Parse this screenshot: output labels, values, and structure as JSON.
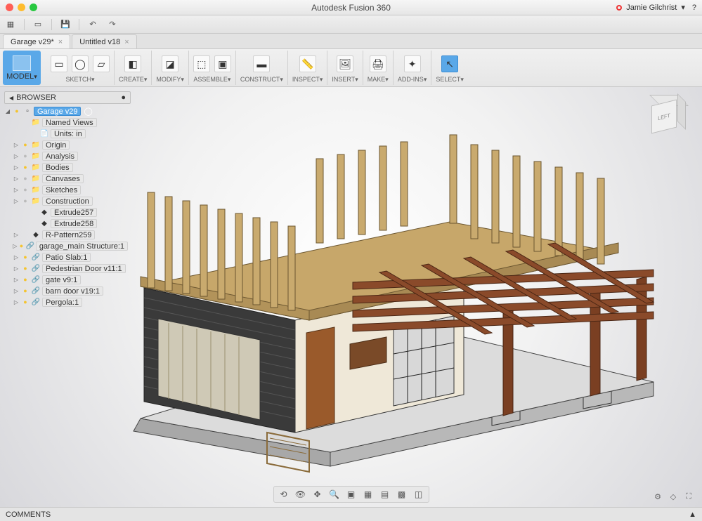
{
  "app_title": "Autodesk Fusion 360",
  "user_name": "Jamie Gilchrist",
  "tabs": [
    {
      "label": "Garage v29*",
      "active": true
    },
    {
      "label": "Untitled v18",
      "active": false
    }
  ],
  "ribbon": {
    "workspace": "MODEL",
    "groups": [
      {
        "label": "SKETCH",
        "icons": [
          "sketch-rect-icon",
          "sketch-circle-icon",
          "sketch-plane-icon"
        ]
      },
      {
        "label": "CREATE",
        "icons": [
          "extrude-icon"
        ]
      },
      {
        "label": "MODIFY",
        "icons": [
          "presspull-icon"
        ]
      },
      {
        "label": "ASSEMBLE",
        "icons": [
          "assemble-icon",
          "component-icon"
        ]
      },
      {
        "label": "CONSTRUCT",
        "icons": [
          "plane-icon"
        ]
      },
      {
        "label": "INSPECT",
        "icons": [
          "measure-icon"
        ]
      },
      {
        "label": "INSERT",
        "icons": [
          "insert-icon"
        ]
      },
      {
        "label": "MAKE",
        "icons": [
          "make-icon"
        ]
      },
      {
        "label": "ADD-INS",
        "icons": [
          "addins-icon"
        ]
      },
      {
        "label": "SELECT",
        "icons": [
          "select-icon"
        ],
        "selected": true
      }
    ]
  },
  "browser": {
    "title": "BROWSER",
    "root": "Garage v29",
    "items": [
      {
        "depth": 1,
        "tri": "",
        "bulb": "",
        "ico": "folder",
        "label": "Named Views"
      },
      {
        "depth": 2,
        "tri": "",
        "bulb": "",
        "ico": "doc",
        "label": "Units: in"
      },
      {
        "depth": 1,
        "tri": "▷",
        "bulb": "on",
        "ico": "folder",
        "label": "Origin"
      },
      {
        "depth": 1,
        "tri": "▷",
        "bulb": "off",
        "ico": "folder",
        "label": "Analysis"
      },
      {
        "depth": 1,
        "tri": "▷",
        "bulb": "on",
        "ico": "folder",
        "label": "Bodies"
      },
      {
        "depth": 1,
        "tri": "▷",
        "bulb": "off",
        "ico": "folder",
        "label": "Canvases"
      },
      {
        "depth": 1,
        "tri": "▷",
        "bulb": "off",
        "ico": "folder",
        "label": "Sketches"
      },
      {
        "depth": 1,
        "tri": "▷",
        "bulb": "off",
        "ico": "folder",
        "label": "Construction"
      },
      {
        "depth": 2,
        "tri": "",
        "bulb": "",
        "ico": "feat",
        "label": "Extrude257"
      },
      {
        "depth": 2,
        "tri": "",
        "bulb": "",
        "ico": "feat",
        "label": "Extrude258"
      },
      {
        "depth": 1,
        "tri": "▷",
        "bulb": "",
        "ico": "feat",
        "label": "R-Pattern259"
      },
      {
        "depth": 1,
        "tri": "▷",
        "bulb": "on",
        "ico": "comp",
        "label": "garage_main Structure:1"
      },
      {
        "depth": 1,
        "tri": "▷",
        "bulb": "on",
        "ico": "comp",
        "label": "Patio Slab:1"
      },
      {
        "depth": 1,
        "tri": "▷",
        "bulb": "on",
        "ico": "comp",
        "label": "Pedestrian Door v11:1"
      },
      {
        "depth": 1,
        "tri": "▷",
        "bulb": "on",
        "ico": "comp",
        "label": "gate v9:1"
      },
      {
        "depth": 1,
        "tri": "▷",
        "bulb": "on",
        "ico": "comp",
        "label": "barn door v19:1"
      },
      {
        "depth": 1,
        "tri": "▷",
        "bulb": "on",
        "ico": "comp",
        "label": "Pergola:1"
      }
    ]
  },
  "viewcube_face": "LEFT",
  "comments_label": "COMMENTS"
}
